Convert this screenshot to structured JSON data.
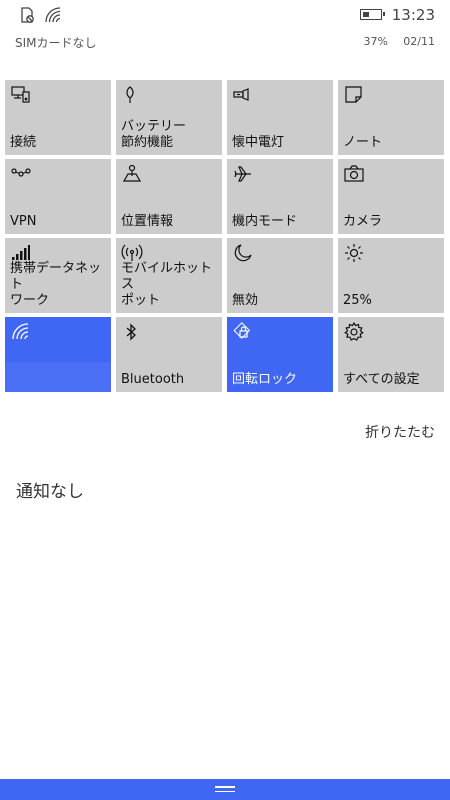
{
  "status_bar": {
    "time": "13:23",
    "carrier": "SIMカードなし",
    "battery_percent": "37%",
    "battery_level": 0.37,
    "date": "02/11",
    "icons": [
      "no-sim-icon",
      "wifi-signal-icon",
      "battery-icon"
    ]
  },
  "tiles": [
    {
      "label": "接続",
      "icon": "connect-icon",
      "active": false
    },
    {
      "label": "バッテリー\n節約機能",
      "icon": "battery-saver-icon",
      "active": false
    },
    {
      "label": "懐中電灯",
      "icon": "flashlight-icon",
      "active": false
    },
    {
      "label": "ノート",
      "icon": "note-icon",
      "active": false
    },
    {
      "label": "VPN",
      "icon": "vpn-icon",
      "active": false
    },
    {
      "label": "位置情報",
      "icon": "location-icon",
      "active": false
    },
    {
      "label": "機内モード",
      "icon": "airplane-icon",
      "active": false
    },
    {
      "label": "カメラ",
      "icon": "camera-icon",
      "active": false
    },
    {
      "label": "携帯データネット\nワーク",
      "icon": "cellular-icon",
      "active": false
    },
    {
      "label": "モバイルホットス\nポット",
      "icon": "hotspot-icon",
      "active": false
    },
    {
      "label": "無効",
      "icon": "quiet-hours-icon",
      "active": false
    },
    {
      "label": "25%",
      "icon": "brightness-icon",
      "active": false
    },
    {
      "label": "",
      "icon": "wifi-icon",
      "active": true
    },
    {
      "label": "Bluetooth",
      "icon": "bluetooth-icon",
      "active": false
    },
    {
      "label": "回転ロック",
      "icon": "rotation-lock-icon",
      "active": true
    },
    {
      "label": "すべての設定",
      "icon": "settings-gear-icon",
      "active": false
    }
  ],
  "collapse_label": "折りたたむ",
  "notifications": {
    "empty_text": "通知なし"
  },
  "colors": {
    "accent": "#3f67f4",
    "tile_bg": "#cccccc",
    "background": "#ffffff"
  }
}
